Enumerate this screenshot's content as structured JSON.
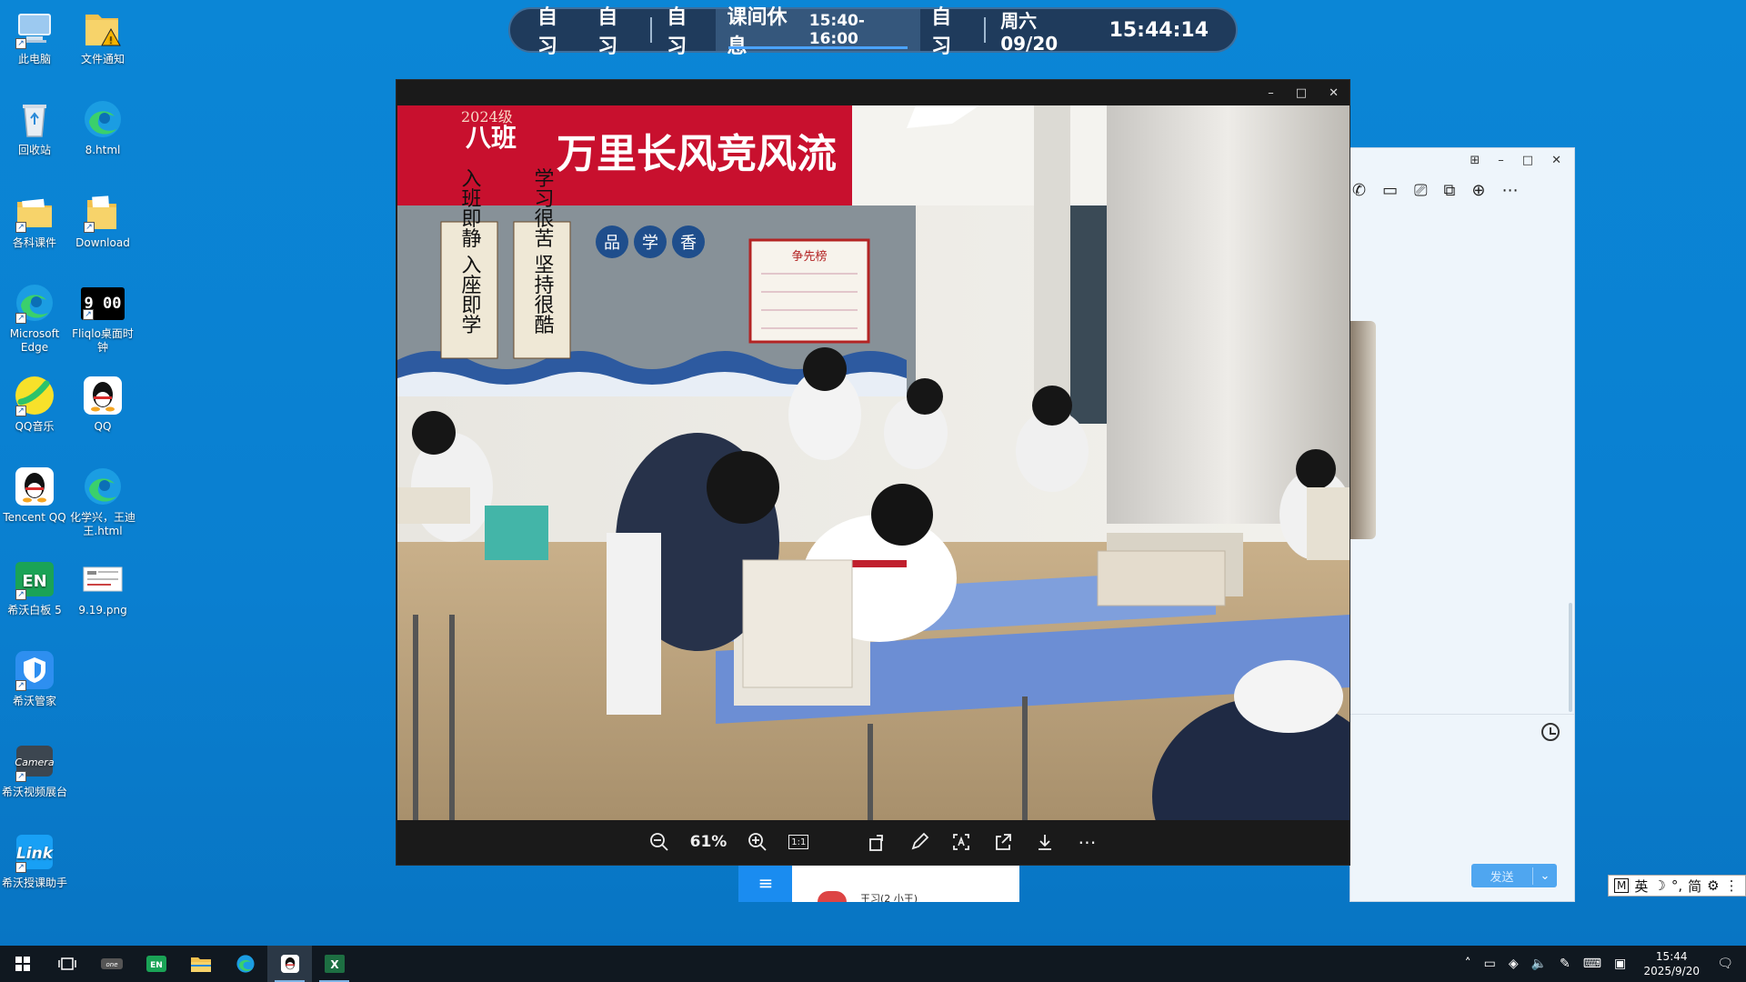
{
  "desktop": {
    "icons": [
      {
        "label": "此电脑",
        "icon": "computer-icon"
      },
      {
        "label": "文件通知",
        "icon": "folder-warning-icon"
      },
      {
        "label": "回收站",
        "icon": "recycle-bin-icon"
      },
      {
        "label": "8.html",
        "icon": "edge-icon"
      },
      {
        "label": "各科课件",
        "icon": "folder-icon"
      },
      {
        "label": "Download",
        "icon": "folder-icon"
      },
      {
        "label": "Microsoft Edge",
        "icon": "edge-icon"
      },
      {
        "label": "Fliqlo桌面时钟",
        "icon": "flip-clock-icon"
      },
      {
        "label": "QQ音乐",
        "icon": "qq-music-icon"
      },
      {
        "label": "QQ",
        "icon": "qq-penguin-icon"
      },
      {
        "label": "Tencent QQ",
        "icon": "qq-penguin-icon"
      },
      {
        "label": "化学兴，王迪王.html",
        "icon": "edge-icon"
      },
      {
        "label": "希沃白板 5",
        "icon": "easinote-icon"
      },
      {
        "label": "9.19.png",
        "icon": "image-file-icon"
      },
      {
        "label": "希沃管家",
        "icon": "shield-icon"
      },
      {
        "label": "希沃视频展台",
        "icon": "camera-icon"
      },
      {
        "label": "希沃授课助手",
        "icon": "link-icon"
      }
    ],
    "flip_clock_text": "9 00"
  },
  "schedule": {
    "items": [
      "自习",
      "自习",
      "自习"
    ],
    "current_label": "课间休息",
    "current_time": "15:40-16:00",
    "next": "自习",
    "date": "周六 09/20",
    "time": "15:44:14"
  },
  "viewer": {
    "zoom": "61%",
    "one_to_one": "1:1",
    "window_controls": {
      "minimize": "–",
      "maximize": "□",
      "close": "✕"
    },
    "photo": {
      "banner_year": "2024级",
      "banner_class": "八班",
      "banner_slogan": "万里长风竞风流",
      "scroll_left": "入班即静 入座即学",
      "scroll_right": "学习很苦 坚持很酷",
      "board_title": "争先榜",
      "board_chars": [
        "品",
        "学",
        "香"
      ]
    }
  },
  "chat": {
    "window_controls": {
      "pin": "⊞",
      "minimize": "–",
      "maximize": "□",
      "close": "✕"
    },
    "send_label": "发送",
    "send_dropdown": "⌄"
  },
  "qq_panel": {
    "menu": "≡",
    "preview_text": "王习(2 小王)"
  },
  "ime": {
    "mode": "M",
    "lang": "英",
    "moon": "☽",
    "punct": "°,",
    "script": "简",
    "settings": "⚙",
    "more": "⋮"
  },
  "taskbar": {
    "apps": [
      "start-icon",
      "task-view-icon",
      "onenote-icon",
      "easinote-icon",
      "file-explorer-icon",
      "edge-icon",
      "qq-penguin-icon",
      "excel-icon"
    ],
    "time": "15:44",
    "date": "2025/9/20"
  },
  "colors": {
    "desktop": "#0b86d6",
    "schedule_bg": "#1f3b5c",
    "banner_red": "#c8102e",
    "taskbar": "#101820",
    "send_btn": "#4fa6f0"
  }
}
